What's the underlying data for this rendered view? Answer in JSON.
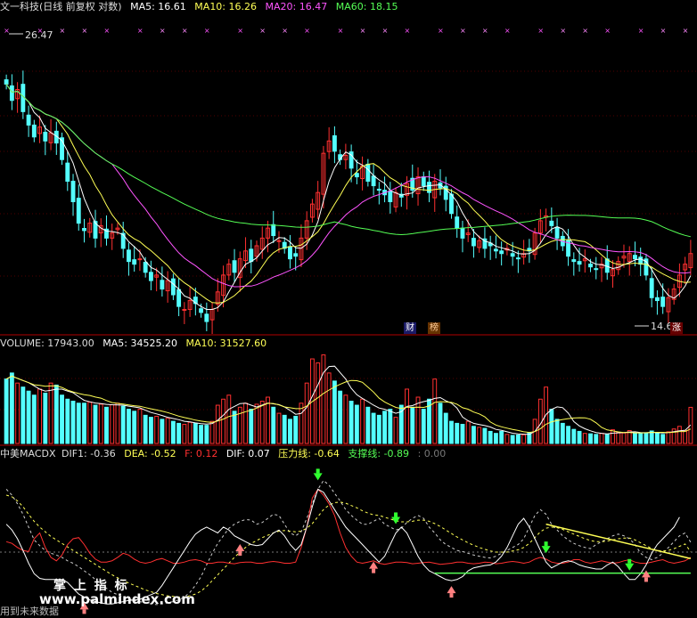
{
  "price_header": {
    "title": "文一科技(日线 前复权 对数)",
    "ma5": "MA5: 16.61",
    "ma10": "MA10: 16.26",
    "ma20": "MA20: 16.47",
    "ma60": "MA60: 18.15"
  },
  "vol_header": {
    "volume": "VOLUME: 17943.00",
    "ma5": "MA5: 34525.20",
    "ma10": "MA10: 31527.60"
  },
  "macd_header": {
    "name": "中美MACDX",
    "dif1": "DIF1: -0.36",
    "dea": "DEA: -0.52",
    "f": "F: 0.12",
    "dif": "DIF: 0.07",
    "pressure": "压力线: -0.64",
    "support": "支撑线: -0.89",
    "extra": ": 0.00"
  },
  "badges": {
    "cai": "财",
    "bang": "榜",
    "zhang": "涨"
  },
  "watermark": {
    "title": "掌 上 指 标",
    "url": "www.palmindex.com",
    "bottom": "用到未来数据"
  },
  "colors": {
    "up": "#ff3030",
    "down": "#54ffff",
    "ma5": "#ffffff",
    "ma10": "#ffff55",
    "ma20": "#ff55ff",
    "ma60": "#55ff55"
  },
  "chart_data": [
    {
      "type": "candlestick",
      "name": "price",
      "y_scale": "log",
      "high_label": "26.47",
      "low_label": "14.63",
      "closes": [
        24.5,
        23.6,
        24.2,
        23.0,
        22.3,
        21.7,
        22.2,
        21.5,
        21.9,
        21.4,
        20.6,
        19.6,
        18.7,
        17.8,
        17.5,
        17.8,
        17.2,
        17.7,
        17.2,
        17.4,
        17.6,
        16.8,
        16.3,
        16.2,
        16.4,
        15.9,
        15.6,
        15.8,
        15.3,
        15.6,
        15.1,
        14.7,
        14.6,
        14.9,
        14.8,
        14.5,
        14.2,
        14.6,
        15.2,
        15.8,
        16.2,
        15.9,
        16.4,
        16.7,
        16.3,
        16.9,
        17.2,
        17.6,
        17.3,
        17.1,
        16.8,
        16.4,
        16.5,
        17.2,
        17.9,
        18.6,
        19.1,
        20.9,
        21.5,
        21.0,
        20.6,
        20.8,
        20.2,
        19.8,
        20.3,
        19.6,
        19.4,
        19.2,
        19.0,
        18.7,
        19.1,
        18.9,
        19.5,
        19.2,
        19.8,
        19.4,
        19.1,
        19.6,
        19.3,
        18.8,
        18.2,
        17.6,
        17.2,
        17.4,
        16.9,
        17.1,
        16.8,
        16.9,
        16.7,
        16.6,
        16.8,
        16.5,
        16.4,
        16.6,
        16.7,
        17.4,
        17.9,
        18.1,
        17.7,
        17.2,
        16.9,
        16.5,
        16.3,
        16.2,
        16.4,
        16.1,
        16.0,
        16.2,
        15.9,
        16.0,
        16.3,
        16.5,
        16.6,
        16.4,
        16.2,
        15.8,
        15.0,
        14.9,
        14.7,
        15.0,
        15.3,
        15.8,
        16.2,
        16.6
      ]
    },
    {
      "type": "bar",
      "name": "volume",
      "values": [
        32000,
        35000,
        30000,
        28000,
        26000,
        24000,
        27000,
        25000,
        30000,
        29000,
        24000,
        22000,
        21000,
        20000,
        20000,
        20500,
        19000,
        19500,
        18000,
        19200,
        20000,
        18500,
        17000,
        16000,
        17000,
        14000,
        13000,
        13500,
        12000,
        12500,
        11000,
        10000,
        9500,
        10500,
        10000,
        9000,
        9000,
        11000,
        19000,
        22000,
        24000,
        16000,
        18000,
        20000,
        17000,
        19500,
        21000,
        23000,
        18000,
        15000,
        14000,
        12000,
        13500,
        20000,
        30000,
        42000,
        40000,
        44000,
        35000,
        31000,
        26000,
        24000,
        21000,
        19000,
        22000,
        18000,
        15000,
        14000,
        16000,
        17000,
        13000,
        19000,
        27000,
        18000,
        23000,
        17000,
        22000,
        32000,
        20000,
        15000,
        11000,
        10000,
        9500,
        11000,
        8500,
        8000,
        7500,
        6000,
        5000,
        6000,
        4500,
        4000,
        4200,
        4300,
        5500,
        12000,
        22000,
        28000,
        17000,
        12000,
        10000,
        8500,
        7000,
        6000,
        5000,
        4800,
        4500,
        5000,
        4600,
        6800,
        5500,
        5200,
        6400,
        5000,
        4900,
        5200,
        6200,
        5500,
        4500,
        5800,
        7200,
        8500,
        6500,
        17943
      ],
      "ma5_label": "MA5",
      "ma10_label": "MA10"
    },
    {
      "type": "line",
      "name": "macd",
      "y_range": [
        -1.6,
        1.0
      ],
      "series": [
        {
          "name": "DIF1",
          "values": [
            0.55,
            0.45,
            0.3,
            0.12,
            -0.1,
            -0.32,
            -0.42,
            -0.5,
            -0.55,
            -0.58,
            -0.62,
            -0.68,
            -0.72,
            -0.78,
            -0.85,
            -0.92,
            -1.0,
            -1.08,
            -1.15,
            -1.22,
            -1.26,
            -1.3,
            -1.33,
            -1.36,
            -1.38,
            -1.4,
            -1.42,
            -1.43,
            -1.42,
            -1.4,
            -1.38,
            -1.35,
            -1.3,
            -1.22,
            -1.1,
            -0.95,
            -0.75,
            -0.55,
            -0.38,
            -0.25,
            -0.12,
            -0.05,
            0.0,
            0.03,
            0.02,
            -0.05,
            -0.02,
            0.05,
            0.12,
            0.1,
            -0.05,
            -0.2,
            -0.25,
            -0.18,
            0.05,
            0.3,
            0.55,
            0.7,
            0.62,
            0.48,
            0.35,
            0.2,
            0.1,
            0.02,
            -0.05,
            -0.05,
            0.0,
            0.05,
            -0.05,
            -0.1,
            -0.15,
            -0.12,
            -0.02,
            0.05,
            0.1,
            0.05,
            -0.1,
            -0.2,
            -0.32,
            -0.4,
            -0.45,
            -0.5,
            -0.52,
            -0.55,
            -0.58,
            -0.6,
            -0.62,
            -0.63,
            -0.6,
            -0.55,
            -0.5,
            -0.45,
            -0.4,
            -0.3,
            -0.1,
            0.1,
            0.2,
            0.12,
            -0.05,
            -0.15,
            -0.25,
            -0.32,
            -0.38,
            -0.42,
            -0.45,
            -0.47,
            -0.4,
            -0.35,
            -0.3,
            -0.25,
            -0.22,
            -0.25,
            -0.3,
            -0.4,
            -0.55,
            -0.62,
            -0.66,
            -0.62,
            -0.55,
            -0.45,
            -0.35,
            -0.25,
            -0.2,
            -0.36
          ]
        },
        {
          "name": "DEA",
          "values": [
            0.45,
            0.42,
            0.35,
            0.25,
            0.12,
            0.0,
            -0.1,
            -0.18,
            -0.26,
            -0.32,
            -0.38,
            -0.44,
            -0.5,
            -0.56,
            -0.62,
            -0.68,
            -0.74,
            -0.8,
            -0.86,
            -0.92,
            -0.97,
            -1.02,
            -1.06,
            -1.1,
            -1.14,
            -1.18,
            -1.21,
            -1.24,
            -1.26,
            -1.28,
            -1.29,
            -1.3,
            -1.3,
            -1.28,
            -1.25,
            -1.2,
            -1.12,
            -1.02,
            -0.92,
            -0.82,
            -0.72,
            -0.62,
            -0.53,
            -0.45,
            -0.38,
            -0.33,
            -0.28,
            -0.24,
            -0.2,
            -0.17,
            -0.16,
            -0.17,
            -0.18,
            -0.17,
            -0.12,
            -0.04,
            0.08,
            0.2,
            0.28,
            0.32,
            0.33,
            0.31,
            0.27,
            0.23,
            0.18,
            0.14,
            0.11,
            0.1,
            0.07,
            0.04,
            0.01,
            -0.01,
            -0.01,
            0.0,
            0.02,
            0.02,
            0.0,
            -0.04,
            -0.09,
            -0.15,
            -0.21,
            -0.27,
            -0.32,
            -0.37,
            -0.41,
            -0.45,
            -0.48,
            -0.51,
            -0.53,
            -0.53,
            -0.53,
            -0.51,
            -0.49,
            -0.45,
            -0.38,
            -0.28,
            -0.18,
            -0.12,
            -0.1,
            -0.11,
            -0.14,
            -0.18,
            -0.22,
            -0.26,
            -0.3,
            -0.33,
            -0.35,
            -0.35,
            -0.34,
            -0.32,
            -0.3,
            -0.29,
            -0.29,
            -0.32,
            -0.37,
            -0.42,
            -0.47,
            -0.5,
            -0.51,
            -0.5,
            -0.47,
            -0.43,
            -0.39,
            -0.52
          ]
        },
        {
          "name": "F",
          "values": [
            -0.35,
            -0.38,
            -0.45,
            -0.5,
            -0.52,
            -0.3,
            -0.2,
            -0.45,
            -0.62,
            -0.68,
            -0.58,
            -0.4,
            -0.3,
            -0.28,
            -0.4,
            -0.55,
            -0.65,
            -0.7,
            -0.7,
            -0.68,
            -0.62,
            -0.55,
            -0.58,
            -0.65,
            -0.7,
            -0.72,
            -0.7,
            -0.66,
            -0.64,
            -0.68,
            -0.72,
            -0.72,
            -0.7,
            -0.67,
            -0.66,
            -0.68,
            -0.72,
            -0.72,
            -0.7,
            -0.7,
            -0.72,
            -0.73,
            -0.71,
            -0.7,
            -0.7,
            -0.72,
            -0.72,
            -0.7,
            -0.69,
            -0.7,
            -0.72,
            -0.72,
            -0.7,
            -0.45,
            -0.1,
            0.4,
            0.55,
            0.45,
            0.3,
            0.1,
            -0.2,
            -0.45,
            -0.6,
            -0.7,
            -0.72,
            -0.7,
            -0.68,
            -0.72,
            -0.74,
            -0.72,
            -0.7,
            -0.7,
            -0.71,
            -0.73,
            -0.72,
            -0.71,
            -0.7,
            -0.72,
            -0.74,
            -0.73,
            -0.72,
            -0.7,
            -0.7,
            -0.72,
            -0.73,
            -0.72,
            -0.7,
            -0.71,
            -0.73,
            -0.72,
            -0.7,
            -0.69,
            -0.7,
            -0.72,
            -0.7,
            -0.65,
            -0.62,
            -0.65,
            -0.7,
            -0.72,
            -0.72,
            -0.7,
            -0.66,
            -0.66,
            -0.7,
            -0.72,
            -0.7,
            -0.68,
            -0.7,
            -0.72,
            -0.71,
            -0.68,
            -0.66,
            -0.7,
            -0.72,
            -0.72,
            -0.7,
            -0.68,
            -0.66,
            -0.7,
            -0.72,
            -0.7,
            -0.68,
            -0.62
          ]
        },
        {
          "name": "DIF",
          "values": [
            -0.05,
            -0.15,
            -0.3,
            -0.5,
            -0.72,
            -0.9,
            -0.98,
            -1.0,
            -1.0,
            -1.0,
            -1.0,
            -1.05,
            -1.15,
            -1.25,
            -1.3,
            -1.35,
            -1.38,
            -1.4,
            -1.42,
            -1.42,
            -1.4,
            -1.38,
            -1.36,
            -1.35,
            -1.34,
            -1.3,
            -1.26,
            -1.22,
            -1.1,
            -0.95,
            -0.8,
            -0.65,
            -0.5,
            -0.35,
            -0.22,
            -0.15,
            -0.1,
            -0.15,
            -0.2,
            -0.1,
            -0.15,
            -0.25,
            -0.3,
            -0.35,
            -0.4,
            -0.42,
            -0.4,
            -0.3,
            -0.2,
            -0.15,
            -0.25,
            -0.4,
            -0.5,
            -0.4,
            -0.1,
            0.25,
            0.55,
            0.5,
            0.35,
            0.2,
            0.05,
            -0.1,
            -0.2,
            -0.3,
            -0.4,
            -0.5,
            -0.6,
            -0.7,
            -0.6,
            -0.4,
            -0.2,
            -0.1,
            -0.2,
            -0.4,
            -0.6,
            -0.75,
            -0.85,
            -0.9,
            -0.95,
            -1.0,
            -1.02,
            -1.0,
            -0.95,
            -0.85,
            -0.8,
            -0.78,
            -0.76,
            -0.75,
            -0.7,
            -0.6,
            -0.45,
            -0.25,
            -0.05,
            0.05,
            -0.1,
            -0.3,
            -0.5,
            -0.7,
            -0.8,
            -0.75,
            -0.7,
            -0.68,
            -0.7,
            -0.75,
            -0.78,
            -0.8,
            -0.82,
            -0.82,
            -0.75,
            -0.7,
            -0.78,
            -0.9,
            -1.0,
            -1.0,
            -0.9,
            -0.75,
            -0.55,
            -0.4,
            -0.3,
            -0.2,
            -0.1,
            0.07
          ]
        }
      ],
      "pressure_line": [
        [
          97,
          -0.05
        ],
        [
          123,
          -0.64
        ]
      ],
      "support_line": [
        [
          77,
          -0.89
        ],
        [
          123,
          -0.89
        ]
      ]
    }
  ]
}
